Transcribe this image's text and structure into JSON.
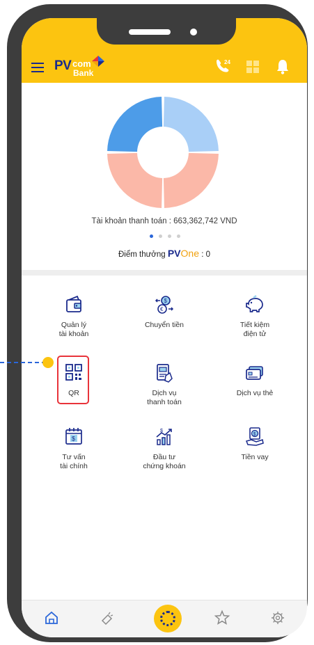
{
  "header": {
    "logo_pv": "PV",
    "logo_com": "com",
    "logo_bank": "Bank",
    "phone_badge": "24"
  },
  "summary": {
    "balance_text": "Tài khoản thanh toán : 663,362,742 VND",
    "points_label": "Điểm thưởng",
    "points_brand_pv": "PV",
    "points_brand_one": "One",
    "points_value": " : 0",
    "carousel_pages": 4,
    "carousel_active": 1
  },
  "chart_data": {
    "type": "pie",
    "labels": [],
    "values": [
      25,
      25,
      25,
      25
    ],
    "colors": [
      "#a9cff7",
      "#fbb8a8",
      "#fbb8a8",
      "#4d9ce8"
    ]
  },
  "menu": {
    "items": [
      {
        "label": "Quản lý\ntài khoản",
        "icon": "wallet-icon"
      },
      {
        "label": "Chuyển tiền",
        "icon": "money-transfer-icon"
      },
      {
        "label": "Tiết kiệm\nđiện tử",
        "icon": "piggy-bank-icon"
      },
      {
        "label": "QR",
        "icon": "qr-code-icon"
      },
      {
        "label": "Dịch vụ\nthanh toán",
        "icon": "payment-receipt-icon"
      },
      {
        "label": "Dịch vụ thẻ",
        "icon": "card-icon"
      },
      {
        "label": "Tư vấn\ntài chính",
        "icon": "calendar-dollar-icon"
      },
      {
        "label": "Đầu tư\nchứng khoán",
        "icon": "stock-chart-icon"
      },
      {
        "label": "Tiền vay",
        "icon": "loan-hand-icon"
      }
    ]
  },
  "bottom_nav": {
    "items": [
      "home-icon",
      "promotion-icon",
      "center-action-icon",
      "star-icon",
      "settings-icon"
    ]
  },
  "colors": {
    "brand_yellow": "#fcc410",
    "brand_navy": "#1a2a8c",
    "highlight_red": "#e8333a",
    "callout_blue": "#2a66d9"
  }
}
